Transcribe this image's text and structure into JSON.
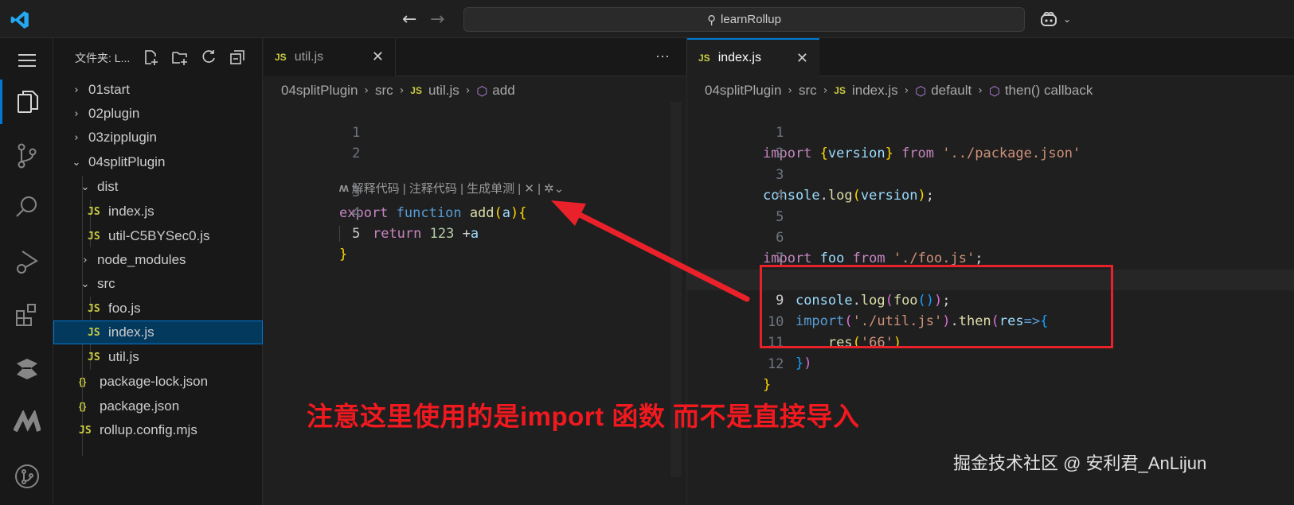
{
  "title_bar": {
    "search_text": "learnRollup"
  },
  "activity_bar": {
    "icons": [
      "menu-icon",
      "explorer-icon",
      "source-control-icon",
      "search-icon",
      "run-debug-icon",
      "extensions-icon",
      "codegeex-icon",
      "marscode-icon",
      "git-graph-icon"
    ]
  },
  "sidebar": {
    "title": "文件夹: L...",
    "tree": [
      {
        "label": "01start",
        "type": "folder",
        "open": false
      },
      {
        "label": "02plugin",
        "type": "folder",
        "open": false
      },
      {
        "label": "03zipplugin",
        "type": "folder",
        "open": false
      },
      {
        "label": "04splitPlugin",
        "type": "folder",
        "open": true
      },
      {
        "label": "dist",
        "type": "folder",
        "open": true
      },
      {
        "label": "index.js",
        "type": "js"
      },
      {
        "label": "util-C5BYSec0.js",
        "type": "js"
      },
      {
        "label": "node_modules",
        "type": "folder",
        "open": false
      },
      {
        "label": "src",
        "type": "folder",
        "open": true
      },
      {
        "label": "foo.js",
        "type": "js"
      },
      {
        "label": "index.js",
        "type": "js",
        "selected": true
      },
      {
        "label": "util.js",
        "type": "js"
      },
      {
        "label": "package-lock.json",
        "type": "json"
      },
      {
        "label": "package.json",
        "type": "json"
      },
      {
        "label": "rollup.config.mjs",
        "type": "js"
      }
    ]
  },
  "editor_left": {
    "tab_label": "util.js",
    "tab_icon": "JS",
    "more_label": "···",
    "breadcrumb": [
      "04splitPlugin",
      "src",
      "util.js",
      "add"
    ],
    "codelens": "解释代码 | 注释代码 | 生成单测 | ✕ |",
    "line_numbers": [
      "1",
      "2",
      "3",
      "4",
      "5"
    ]
  },
  "editor_right": {
    "tab_label": "index.js",
    "tab_icon": "JS",
    "breadcrumb": [
      "04splitPlugin",
      "src",
      "index.js",
      "default",
      "then() callback"
    ],
    "line_numbers": [
      "1",
      "2",
      "3",
      "4",
      "5",
      "6",
      "7",
      "8",
      "9",
      "10",
      "11",
      "12"
    ]
  },
  "annotation": {
    "note": "注意这里使用的是import 函数 而不是直接导入",
    "watermark": "掘金技术社区 @ 安利君_AnLijun"
  }
}
